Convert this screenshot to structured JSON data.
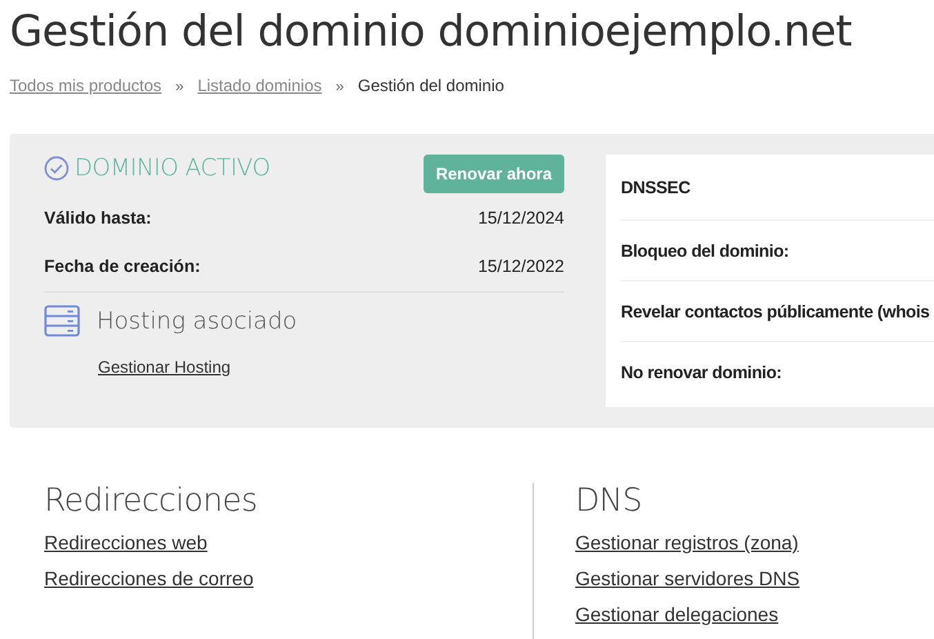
{
  "title": "Gestión del dominio dominioejemplo.net",
  "breadcrumb": [
    {
      "label": "Todos mis productos",
      "kind": "link"
    },
    {
      "label": "»",
      "kind": "sep"
    },
    {
      "label": "Listado dominios",
      "kind": "link"
    },
    {
      "label": "»",
      "kind": "sep"
    },
    {
      "label": "Gestión del dominio",
      "kind": "current"
    }
  ],
  "status": {
    "label": "DOMINIO ACTIVO",
    "active": true
  },
  "renew_button": "Renovar ahora",
  "dates": [
    {
      "label": "Válido hasta:",
      "value": "15/12/2024"
    },
    {
      "label": "Fecha de creación:",
      "value": "15/12/2022"
    }
  ],
  "hosting": {
    "title": "Hosting asociado",
    "link": "Gestionar Hosting"
  },
  "settings": [
    "DNSSEC",
    "Bloqueo del dominio:",
    "Revelar contactos públicamente (whois",
    "No renovar dominio:"
  ],
  "sections": [
    {
      "title": "Redirecciones",
      "links": [
        "Redirecciones web",
        "Redirecciones de correo"
      ]
    },
    {
      "title": "DNS",
      "links": [
        "Gestionar registros (zona)",
        "Gestionar servidores DNS",
        "Gestionar delegaciones"
      ]
    }
  ]
}
